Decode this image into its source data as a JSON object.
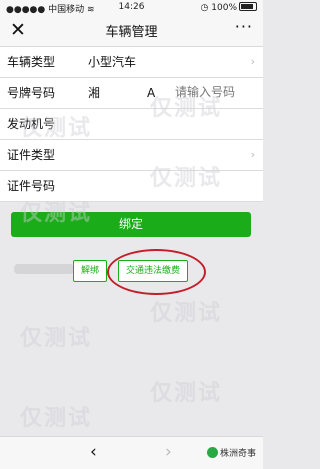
{
  "status": {
    "carrier": "中国移动",
    "time": "14:26",
    "battery": "100%"
  },
  "nav": {
    "close": "✕",
    "title": "车辆管理",
    "more": "···"
  },
  "form": {
    "vehicle_type_label": "车辆类型",
    "vehicle_type_value": "小型汽车",
    "plate_label": "号牌号码",
    "plate_prefix": "湘",
    "plate_letter": "A",
    "plate_placeholder": "请输入号码",
    "engine_label": "发动机号",
    "cert_type_label": "证件类型",
    "cert_no_label": "证件号码"
  },
  "actions": {
    "bind": "绑定",
    "unbind": "解绑",
    "pay_violation": "交通违法缴费"
  },
  "bottom": {
    "back": "‹",
    "forward": "›",
    "brand": "株洲奇事"
  },
  "watermark": "仅测试"
}
